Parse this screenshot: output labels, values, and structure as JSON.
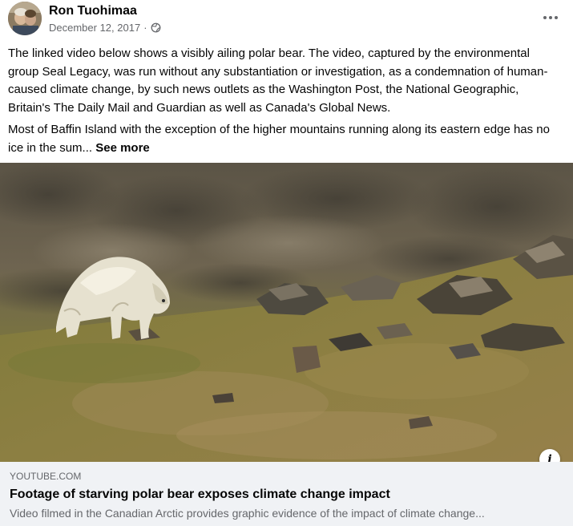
{
  "post": {
    "author": "Ron Tuohimaa",
    "date": "December 12, 2017",
    "separator": "·",
    "privacy_icon": "globe-icon",
    "more_icon": "more-options-icon",
    "paragraph_1": "The linked video below shows a visibly ailing polar bear. The video, captured by the environmental group Seal Legacy, was run without any substantiation or investigation, as a condemnation of human-caused climate change, by such news outlets as the Washington Post, the National Geographic, Britain's The Daily Mail and Guardian as well as Canada's Global News.",
    "paragraph_2": "Most of Baffin Island with the exception of the higher mountains running along its eastern edge has no ice in the sum...",
    "see_more": "See more"
  },
  "link_card": {
    "domain": "YOUTUBE.COM",
    "title": "Footage of starving polar bear exposes climate change impact",
    "description": "Video filmed in the Canadian Arctic provides graphic evidence of the impact of climate change...",
    "info_icon_label": "i"
  },
  "colors": {
    "text_primary": "#050505",
    "text_secondary": "#65676b",
    "card_background": "#f0f2f5"
  }
}
